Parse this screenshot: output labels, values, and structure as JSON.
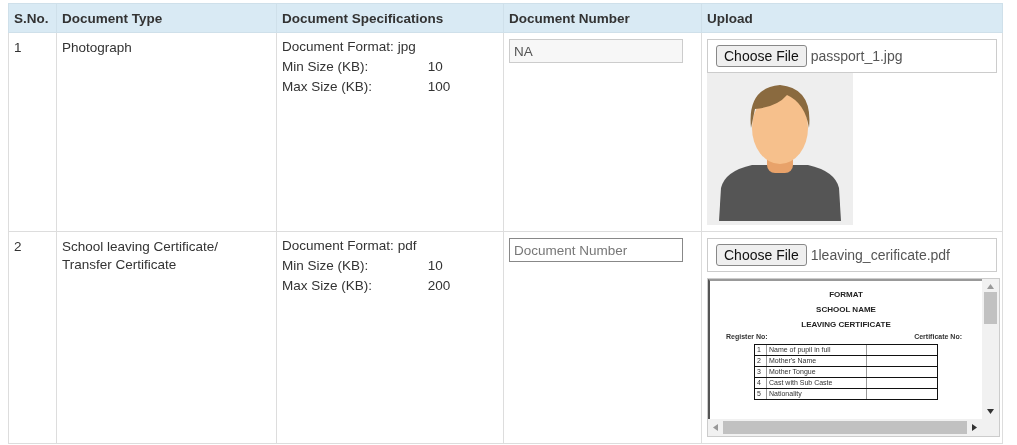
{
  "table": {
    "columns": [
      "S.No.",
      "Document Type",
      "Document Specifications",
      "Document Number",
      "Upload"
    ],
    "rows": [
      {
        "sno": "1",
        "type": [
          "Photograph"
        ],
        "specs": [
          {
            "label": "Document Format:",
            "value": "jpg"
          },
          {
            "label": "Min Size (KB):",
            "value": "10"
          },
          {
            "label": "Max Size (KB):",
            "value": "100"
          }
        ],
        "number": {
          "value": "NA"
        },
        "upload": {
          "button": "Choose File",
          "file": "passport_1.jpg",
          "preview": {
            "kind": "photo"
          }
        }
      },
      {
        "sno": "2",
        "type": [
          "School leaving Certificate/",
          "Transfer Certificate"
        ],
        "specs": [
          {
            "label": "Document Format:",
            "value": "pdf"
          },
          {
            "label": "Min Size (KB):",
            "value": "10"
          },
          {
            "label": "Max Size (KB):",
            "value": "200"
          }
        ],
        "number": {
          "placeholder": "Document Number"
        },
        "upload": {
          "button": "Choose File",
          "file": "1leaving_cerificate.pdf",
          "preview": {
            "kind": "document",
            "headings": [
              "FORMAT",
              "SCHOOL NAME",
              "LEAVING CERTIFICATE"
            ],
            "left_label": "Register No:",
            "right_label": "Certificate No:",
            "rows": [
              {
                "no": "1",
                "label": "Name of pupil in full"
              },
              {
                "no": "2",
                "label": "Mother's Name"
              },
              {
                "no": "3",
                "label": "Mother Tongue"
              },
              {
                "no": "4",
                "label": "Cast with Sub Caste"
              },
              {
                "no": "5",
                "label": "Nationality"
              }
            ]
          }
        }
      }
    ]
  }
}
